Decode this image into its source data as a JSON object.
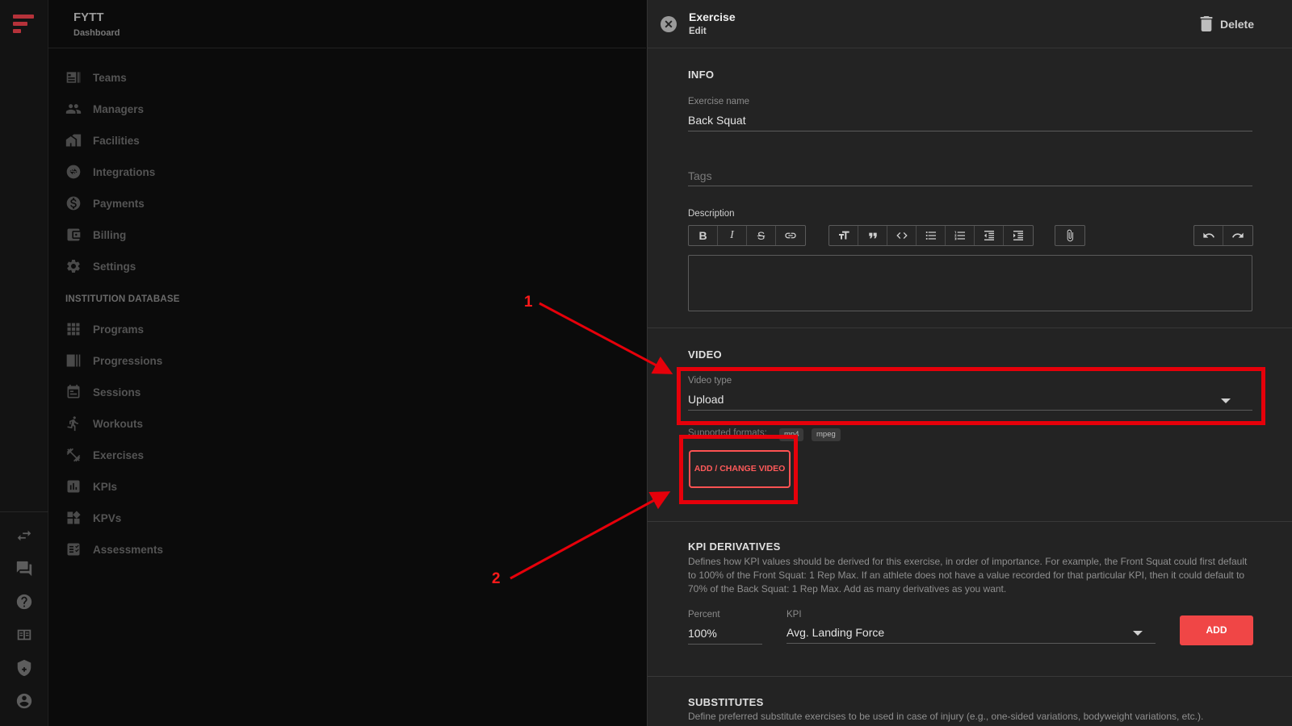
{
  "app": {
    "name": "FYTT",
    "subtitle": "Dashboard"
  },
  "nav": {
    "items": [
      {
        "label": "Teams",
        "icon": "teams-icon"
      },
      {
        "label": "Managers",
        "icon": "managers-icon"
      },
      {
        "label": "Facilities",
        "icon": "facilities-icon"
      },
      {
        "label": "Integrations",
        "icon": "integrations-icon"
      },
      {
        "label": "Payments",
        "icon": "payments-icon"
      },
      {
        "label": "Billing",
        "icon": "billing-icon"
      },
      {
        "label": "Settings",
        "icon": "settings-icon"
      }
    ],
    "section_label": "INSTITUTION DATABASE",
    "db_items": [
      {
        "label": "Programs",
        "icon": "programs-icon"
      },
      {
        "label": "Progressions",
        "icon": "progressions-icon"
      },
      {
        "label": "Sessions",
        "icon": "sessions-icon"
      },
      {
        "label": "Workouts",
        "icon": "workouts-icon"
      },
      {
        "label": "Exercises",
        "icon": "exercises-icon"
      },
      {
        "label": "KPIs",
        "icon": "kpis-icon"
      },
      {
        "label": "KPVs",
        "icon": "kpvs-icon"
      },
      {
        "label": "Assessments",
        "icon": "assessments-icon"
      }
    ]
  },
  "rail_icons": [
    "swap-icon",
    "chat-icon",
    "help-icon",
    "book-icon",
    "shield-icon",
    "account-icon"
  ],
  "panel": {
    "title": "Exercise",
    "subtitle": "Edit",
    "delete_label": "Delete",
    "info": {
      "section": "INFO",
      "name_label": "Exercise name",
      "name_value": "Back Squat",
      "tags_placeholder": "Tags",
      "description_label": "Description"
    },
    "toolbar_icons": [
      "bold-icon",
      "italic-icon",
      "strikethrough-icon",
      "link-icon",
      "heading-icon",
      "quote-icon",
      "code-icon",
      "bullet-list-icon",
      "numbered-list-icon",
      "outdent-icon",
      "indent-icon",
      "attachment-icon",
      "undo-icon",
      "redo-icon"
    ],
    "video": {
      "section": "VIDEO",
      "type_label": "Video type",
      "type_value": "Upload",
      "formats_label": "Supported formats:",
      "formats": [
        "mp4",
        "mpeg"
      ],
      "add_button": "ADD / CHANGE VIDEO"
    },
    "kpi": {
      "section": "KPI DERIVATIVES",
      "description": "Defines how KPI values should be derived for this exercise, in order of importance. For example, the Front Squat could first default to 100% of the Front Squat: 1 Rep Max. If an athlete does not have a value recorded for that particular KPI, then it could default to 70% of the Back Squat: 1 Rep Max. Add as many derivatives as you want.",
      "percent_label": "Percent",
      "percent_value": "100%",
      "kpi_label": "KPI",
      "kpi_value": "Avg. Landing Force",
      "add_button": "ADD"
    },
    "substitutes": {
      "section": "SUBSTITUTES",
      "description": "Define preferred substitute exercises to be used in case of injury (e.g., one-sided variations, bodyweight variations, etc.)."
    }
  },
  "annotations": {
    "one": "1",
    "two": "2",
    "color": "#e6000a"
  }
}
